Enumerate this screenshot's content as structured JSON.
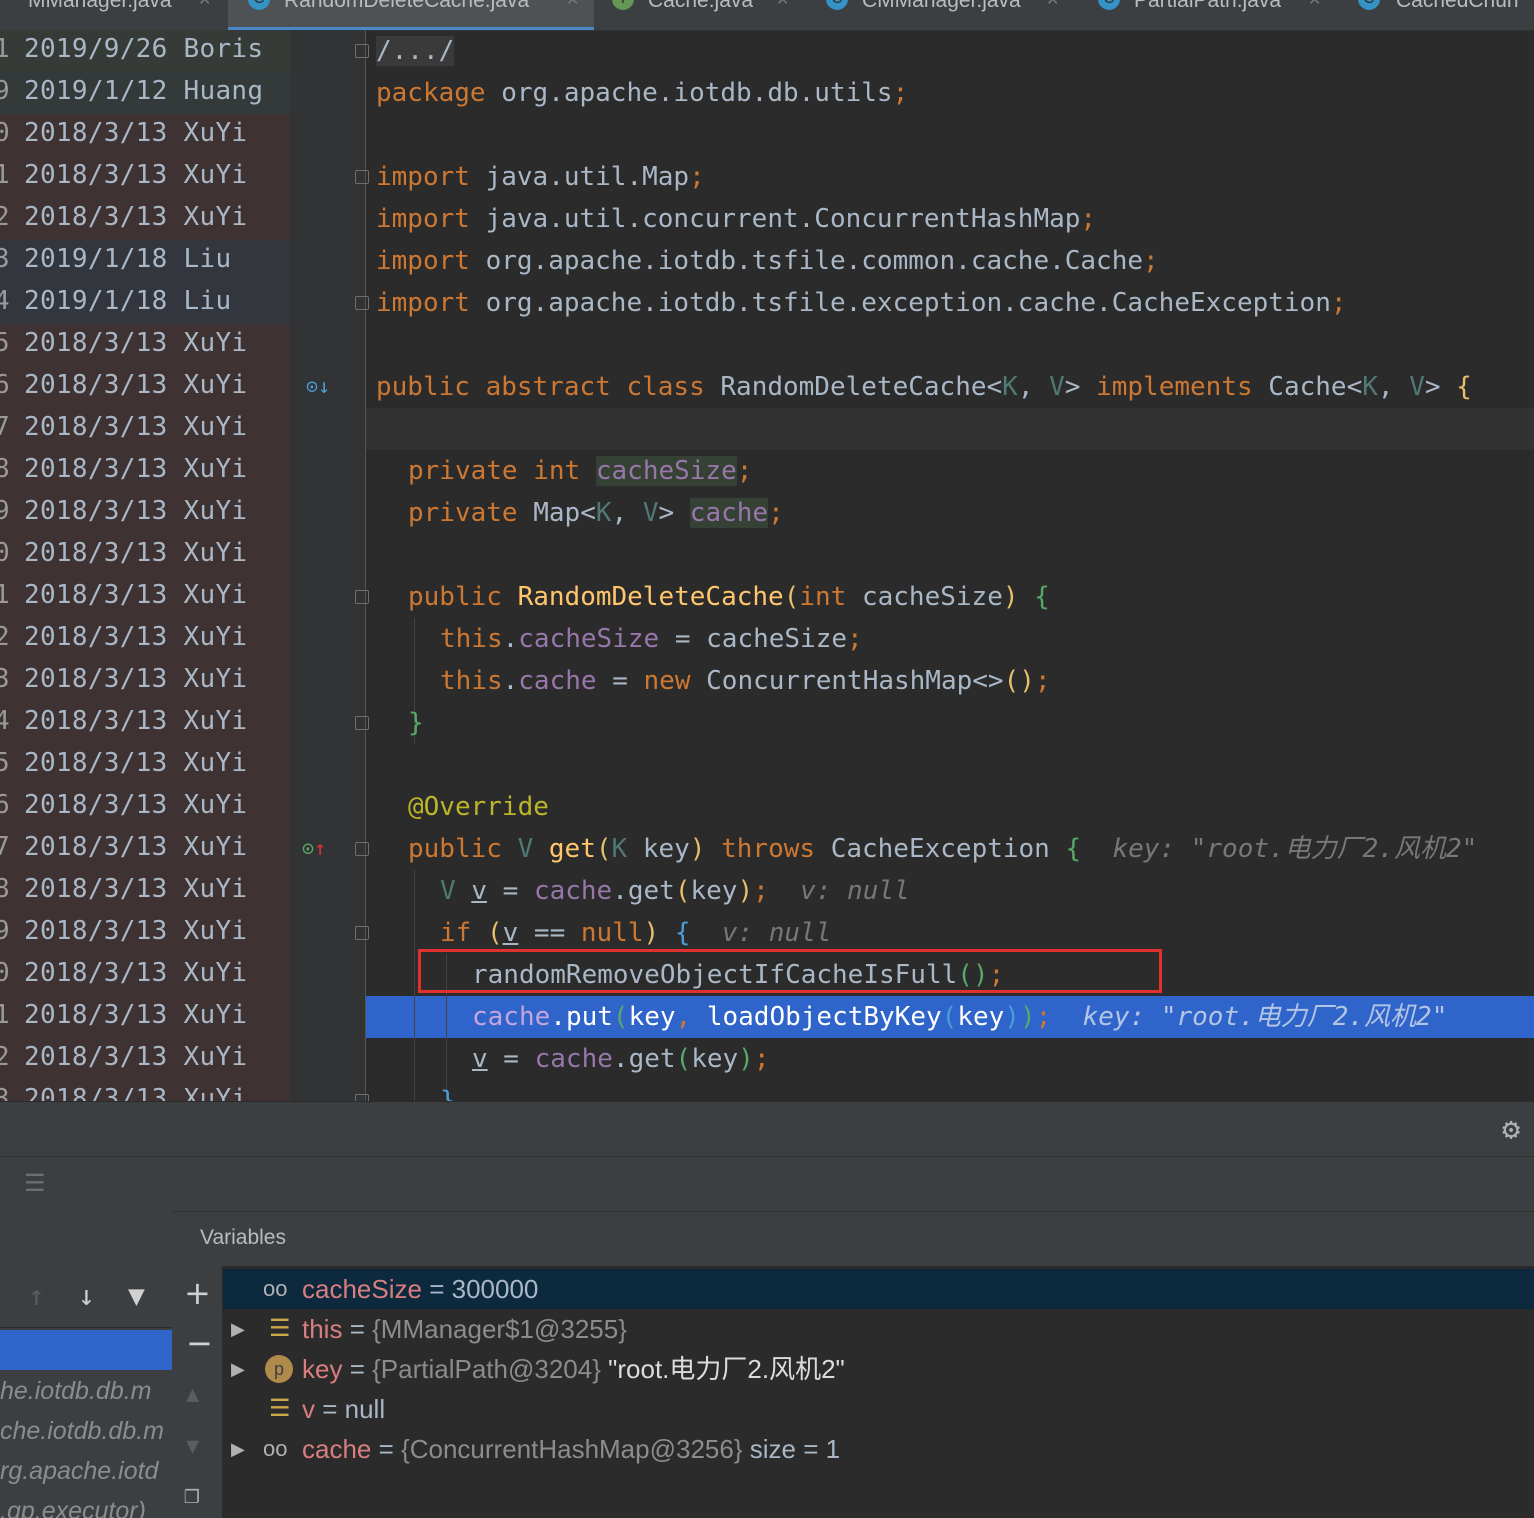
{
  "tabs": [
    {
      "label": "MManager.java",
      "icon": "C"
    },
    {
      "label": "RandomDeleteCache.java",
      "icon": "C",
      "active": true
    },
    {
      "label": "Cache.java",
      "icon": "I"
    },
    {
      "label": "CMManager.java",
      "icon": "C"
    },
    {
      "label": "PartialPath.java",
      "icon": "C"
    },
    {
      "label": "CachedChun",
      "icon": "C"
    }
  ],
  "annotations": [
    {
      "ln": "1",
      "text": "2019/9/26 Boris"
    },
    {
      "ln": "9",
      "text": "2019/1/12 Huang"
    },
    {
      "ln": "0",
      "text": "2018/3/13 XuYi"
    },
    {
      "ln": "1",
      "text": "2018/3/13 XuYi"
    },
    {
      "ln": "2",
      "text": "2018/3/13 XuYi"
    },
    {
      "ln": "3",
      "text": "2019/1/18 Liu"
    },
    {
      "ln": "4",
      "text": "2019/1/18 Liu"
    },
    {
      "ln": "5",
      "text": "2018/3/13 XuYi"
    },
    {
      "ln": "6",
      "text": "2018/3/13 XuYi"
    },
    {
      "ln": "7",
      "text": "2018/3/13 XuYi"
    },
    {
      "ln": "8",
      "text": "2018/3/13 XuYi"
    },
    {
      "ln": "9",
      "text": "2018/3/13 XuYi"
    },
    {
      "ln": "0",
      "text": "2018/3/13 XuYi"
    },
    {
      "ln": "1",
      "text": "2018/3/13 XuYi"
    },
    {
      "ln": "2",
      "text": "2018/3/13 XuYi"
    },
    {
      "ln": "3",
      "text": "2018/3/13 XuYi"
    },
    {
      "ln": "4",
      "text": "2018/3/13 XuYi"
    },
    {
      "ln": "5",
      "text": "2018/3/13 XuYi"
    },
    {
      "ln": "6",
      "text": "2018/3/13 XuYi"
    },
    {
      "ln": "7",
      "text": "2018/3/13 XuYi"
    },
    {
      "ln": "8",
      "text": "2018/3/13 XuYi"
    },
    {
      "ln": "9",
      "text": "2018/3/13 XuYi"
    },
    {
      "ln": "0",
      "text": "2018/3/13 XuYi"
    },
    {
      "ln": "1",
      "text": "2018/3/13 XuYi"
    },
    {
      "ln": "2",
      "text": "2018/3/13 XuYi"
    },
    {
      "ln": "3",
      "text": "2018/3/13 XuYi"
    }
  ],
  "code": {
    "l01": "/.../",
    "l02_kw": "package",
    "l02_rest": " org.apache.iotdb.db.utils",
    "l04": "java.util.Map",
    "l05": "java.util.concurrent.ConcurrentHashMap",
    "l06": "org.apache.iotdb.tsfile.common.cache.Cache",
    "l07": "org.apache.iotdb.tsfile.exception.cache.CacheException",
    "import_kw": "import",
    "l09_kw": "public abstract class",
    "l09_name": "RandomDeleteCache",
    "l09_impl": "implements",
    "l09_iface": "Cache",
    "l11_field": "cacheSize",
    "l12_map": "Map",
    "l12_field": "cache",
    "l14_ctor": "RandomDeleteCache",
    "l14_param": "cacheSize",
    "l15_this": "this",
    "l15_field": "cacheSize",
    "l15_rhs": "cacheSize",
    "l16_field": "cache",
    "l16_new": "new",
    "l16_type": "ConcurrentHashMap",
    "l19_ann": "@Override",
    "l20_name": "get",
    "l20_throws": "throws",
    "l20_exc": "CacheException",
    "l20_hint": "key: \"root.电力厂2.风机2\"",
    "l21_var": "v",
    "l21_hint": "v: null",
    "l22_null": "null",
    "l22_hint": "v: null",
    "l23_call": "randomRemoveObjectIfCacheIsFull",
    "l24_field": "cache",
    "l24_put": "put",
    "l24_key": "key",
    "l24_load": "loadObjectByKey",
    "l24_hint": "key: \"root.电力厂2.风机2\"",
    "l25_get": "get",
    "kw_private": "private",
    "kw_public": "public",
    "kw_int": "int",
    "kw_if": "if",
    "kw_V": "V",
    "kw_K": "K"
  },
  "debugger": {
    "variables_title": "Variables",
    "frames": [
      "he.iotdb.db.m",
      "che.iotdb.db.m",
      "rg.apache.iotd",
      ".gp.executor)"
    ],
    "vars": [
      {
        "icon": "watch",
        "name": "cacheSize",
        "eq": " = ",
        "value": "300000",
        "selected": true
      },
      {
        "icon": "field",
        "name": "this",
        "eq": " = ",
        "value": "{MManager$1@3255}",
        "expand": true
      },
      {
        "icon": "param",
        "name": "key",
        "eq": " = ",
        "value": "{PartialPath@3204}",
        "extra": "\"root.电力厂2.风机2\"",
        "expand": true
      },
      {
        "icon": "field",
        "name": "v",
        "eq": " = ",
        "value": "null"
      },
      {
        "icon": "watch",
        "name": "cache",
        "eq": " = ",
        "value": "{ConcurrentHashMap@3256}",
        "extra": "size = 1",
        "expand": true
      }
    ]
  },
  "colors": {
    "selection": "#2f65ca",
    "redbox": "#e0312f",
    "annotation_xuyi": "#3f3233",
    "annotation_liu": "#33363d",
    "annotation_boris": "#363b37"
  }
}
